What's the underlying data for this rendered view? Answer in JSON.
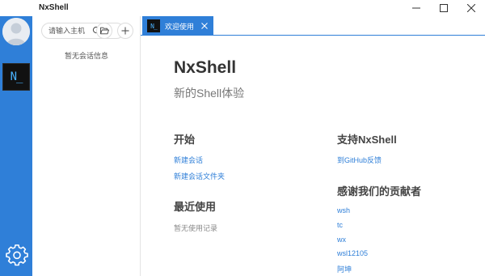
{
  "window": {
    "title": "NxShell"
  },
  "rail": {
    "app_icon_text": "N_"
  },
  "session_panel": {
    "search_placeholder": "请输入主机",
    "empty_text": "暂无会话信息"
  },
  "tabs": [
    {
      "icon_text": "N_",
      "label": "欢迎使用"
    }
  ],
  "welcome": {
    "title": "NxShell",
    "subtitle": "新的Shell体验",
    "start": {
      "heading": "开始",
      "links": [
        "新建会话",
        "新建会话文件夹"
      ]
    },
    "recent": {
      "heading": "最近使用",
      "empty": "暂无使用记录"
    },
    "support": {
      "heading": "支持NxShell",
      "link": "到GitHub反馈"
    },
    "contributors": {
      "heading": "感谢我们的贡献者",
      "names": [
        "wsh",
        "tc",
        "wx",
        "wsl12105",
        "阿坤"
      ]
    }
  },
  "colors": {
    "accent": "#2f7fd8",
    "rail": "#2f7fd8",
    "text_primary": "#333333",
    "text_muted": "#888888"
  }
}
